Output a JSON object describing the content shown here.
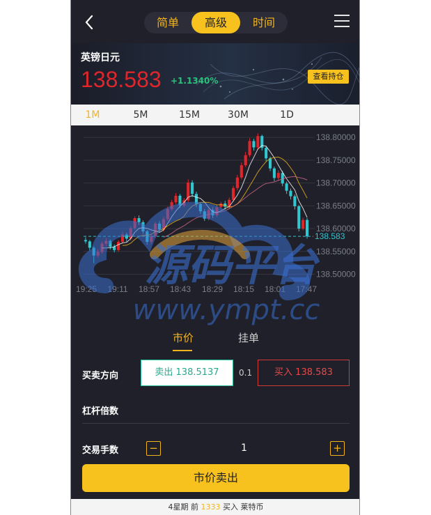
{
  "header": {
    "tabs": [
      {
        "label": "简单",
        "active": false
      },
      {
        "label": "高级",
        "active": true
      },
      {
        "label": "时间",
        "active": false
      }
    ]
  },
  "quote": {
    "pair_name": "英镑日元",
    "price": "138.583",
    "change": "+1.1340%",
    "positions_button": "查看持仓"
  },
  "periods": [
    "1M",
    "5M",
    "15M",
    "30M",
    "1D"
  ],
  "active_period": "1M",
  "watermark": {
    "text_cn": "源码平台",
    "text_url": "www.ympt.cc"
  },
  "chart_data": {
    "type": "candlestick",
    "y_ticks": [
      "138.80000",
      "138.75000",
      "138.70000",
      "138.65000",
      "138.60000",
      "138.55000",
      "138.50000"
    ],
    "y_tick_values": [
      138.8,
      138.75,
      138.7,
      138.65,
      138.6,
      138.55,
      138.5
    ],
    "x_ticks": [
      "19:25",
      "19:11",
      "18:57",
      "18:43",
      "18:29",
      "18:15",
      "18:01",
      "17:47"
    ],
    "ylim": [
      138.487,
      138.814
    ],
    "current_price_label": "138.583",
    "current_price": 138.583,
    "colors": {
      "up": "#e0262b",
      "down": "#31c6d0",
      "ma1": "#ffffff",
      "ma2": "#f2b51e",
      "ma3": "#d26a8a"
    },
    "candles": [
      [
        138.575,
        138.572,
        138.581,
        138.567
      ],
      [
        138.572,
        138.558,
        138.575,
        138.552
      ],
      [
        138.558,
        138.541,
        138.561,
        138.524
      ],
      [
        138.541,
        138.549,
        138.555,
        138.537
      ],
      [
        138.549,
        138.567,
        138.571,
        138.545
      ],
      [
        138.567,
        138.573,
        138.579,
        138.561
      ],
      [
        138.573,
        138.56,
        138.576,
        138.554
      ],
      [
        138.56,
        138.553,
        138.565,
        138.548
      ],
      [
        138.553,
        138.571,
        138.575,
        138.549
      ],
      [
        138.571,
        138.587,
        138.593,
        138.567
      ],
      [
        138.587,
        138.578,
        138.591,
        138.571
      ],
      [
        138.578,
        138.601,
        138.606,
        138.574
      ],
      [
        138.601,
        138.623,
        138.627,
        138.597
      ],
      [
        138.623,
        138.614,
        138.629,
        138.608
      ],
      [
        138.614,
        138.594,
        138.618,
        138.589
      ],
      [
        138.594,
        138.571,
        138.597,
        138.565
      ],
      [
        138.571,
        138.584,
        138.589,
        138.566
      ],
      [
        138.584,
        138.611,
        138.615,
        138.58
      ],
      [
        138.611,
        138.598,
        138.616,
        138.592
      ],
      [
        138.598,
        138.621,
        138.626,
        138.594
      ],
      [
        138.621,
        138.643,
        138.648,
        138.617
      ],
      [
        138.643,
        138.658,
        138.663,
        138.639
      ],
      [
        138.658,
        138.672,
        138.678,
        138.654
      ],
      [
        138.672,
        138.651,
        138.676,
        138.645
      ],
      [
        138.651,
        138.662,
        138.667,
        138.647
      ],
      [
        138.662,
        138.701,
        138.708,
        138.658
      ],
      [
        138.701,
        138.676,
        138.706,
        138.669
      ],
      [
        138.676,
        138.654,
        138.681,
        138.647
      ],
      [
        138.654,
        138.638,
        138.658,
        138.632
      ],
      [
        138.638,
        138.622,
        138.643,
        138.617
      ],
      [
        138.622,
        138.641,
        138.646,
        138.618
      ],
      [
        138.641,
        138.629,
        138.647,
        138.623
      ],
      [
        138.629,
        138.647,
        138.652,
        138.625
      ],
      [
        138.647,
        138.655,
        138.659,
        138.642
      ],
      [
        138.655,
        138.648,
        138.661,
        138.642
      ],
      [
        138.648,
        138.663,
        138.668,
        138.644
      ],
      [
        138.663,
        138.689,
        138.694,
        138.659
      ],
      [
        138.689,
        138.712,
        138.718,
        138.684
      ],
      [
        138.712,
        138.739,
        138.745,
        138.708
      ],
      [
        138.739,
        138.761,
        138.768,
        138.735
      ],
      [
        138.761,
        138.792,
        138.798,
        138.757
      ],
      [
        138.792,
        138.778,
        138.797,
        138.771
      ],
      [
        138.778,
        138.803,
        138.809,
        138.773
      ],
      [
        138.803,
        138.777,
        138.806,
        138.771
      ],
      [
        138.777,
        138.754,
        138.781,
        138.748
      ],
      [
        138.754,
        138.732,
        138.758,
        138.726
      ],
      [
        138.732,
        138.711,
        138.736,
        138.704
      ],
      [
        138.711,
        138.722,
        138.728,
        138.706
      ],
      [
        138.722,
        138.699,
        138.727,
        138.693
      ],
      [
        138.699,
        138.683,
        138.703,
        138.676
      ],
      [
        138.683,
        138.671,
        138.688,
        138.664
      ],
      [
        138.671,
        138.649,
        138.675,
        138.642
      ],
      [
        138.649,
        138.6,
        138.652,
        138.594
      ],
      [
        138.6,
        138.619,
        138.624,
        138.596
      ],
      [
        138.619,
        138.583,
        138.623,
        138.578
      ]
    ]
  },
  "order": {
    "tabs": [
      {
        "label": "市价",
        "active": true
      },
      {
        "label": "挂单",
        "active": false
      }
    ],
    "direction_label": "买卖方向",
    "sell_label": "卖出 138.5137",
    "spread": "0.1",
    "buy_label": "买入 138.583",
    "leverage_label": "杠杆倍数",
    "lots_label": "交易手数",
    "minus": "−",
    "plus": "+",
    "lots_value": "1",
    "submit_label": "市价卖出"
  },
  "footer": {
    "pre": "4星期 前",
    "count": "1333",
    "post": "买入 莱特币"
  },
  "colors": {
    "accent": "#f7c11e",
    "background": "#1f2029",
    "price_red": "#e0262b",
    "up_green": "#29c37c"
  }
}
